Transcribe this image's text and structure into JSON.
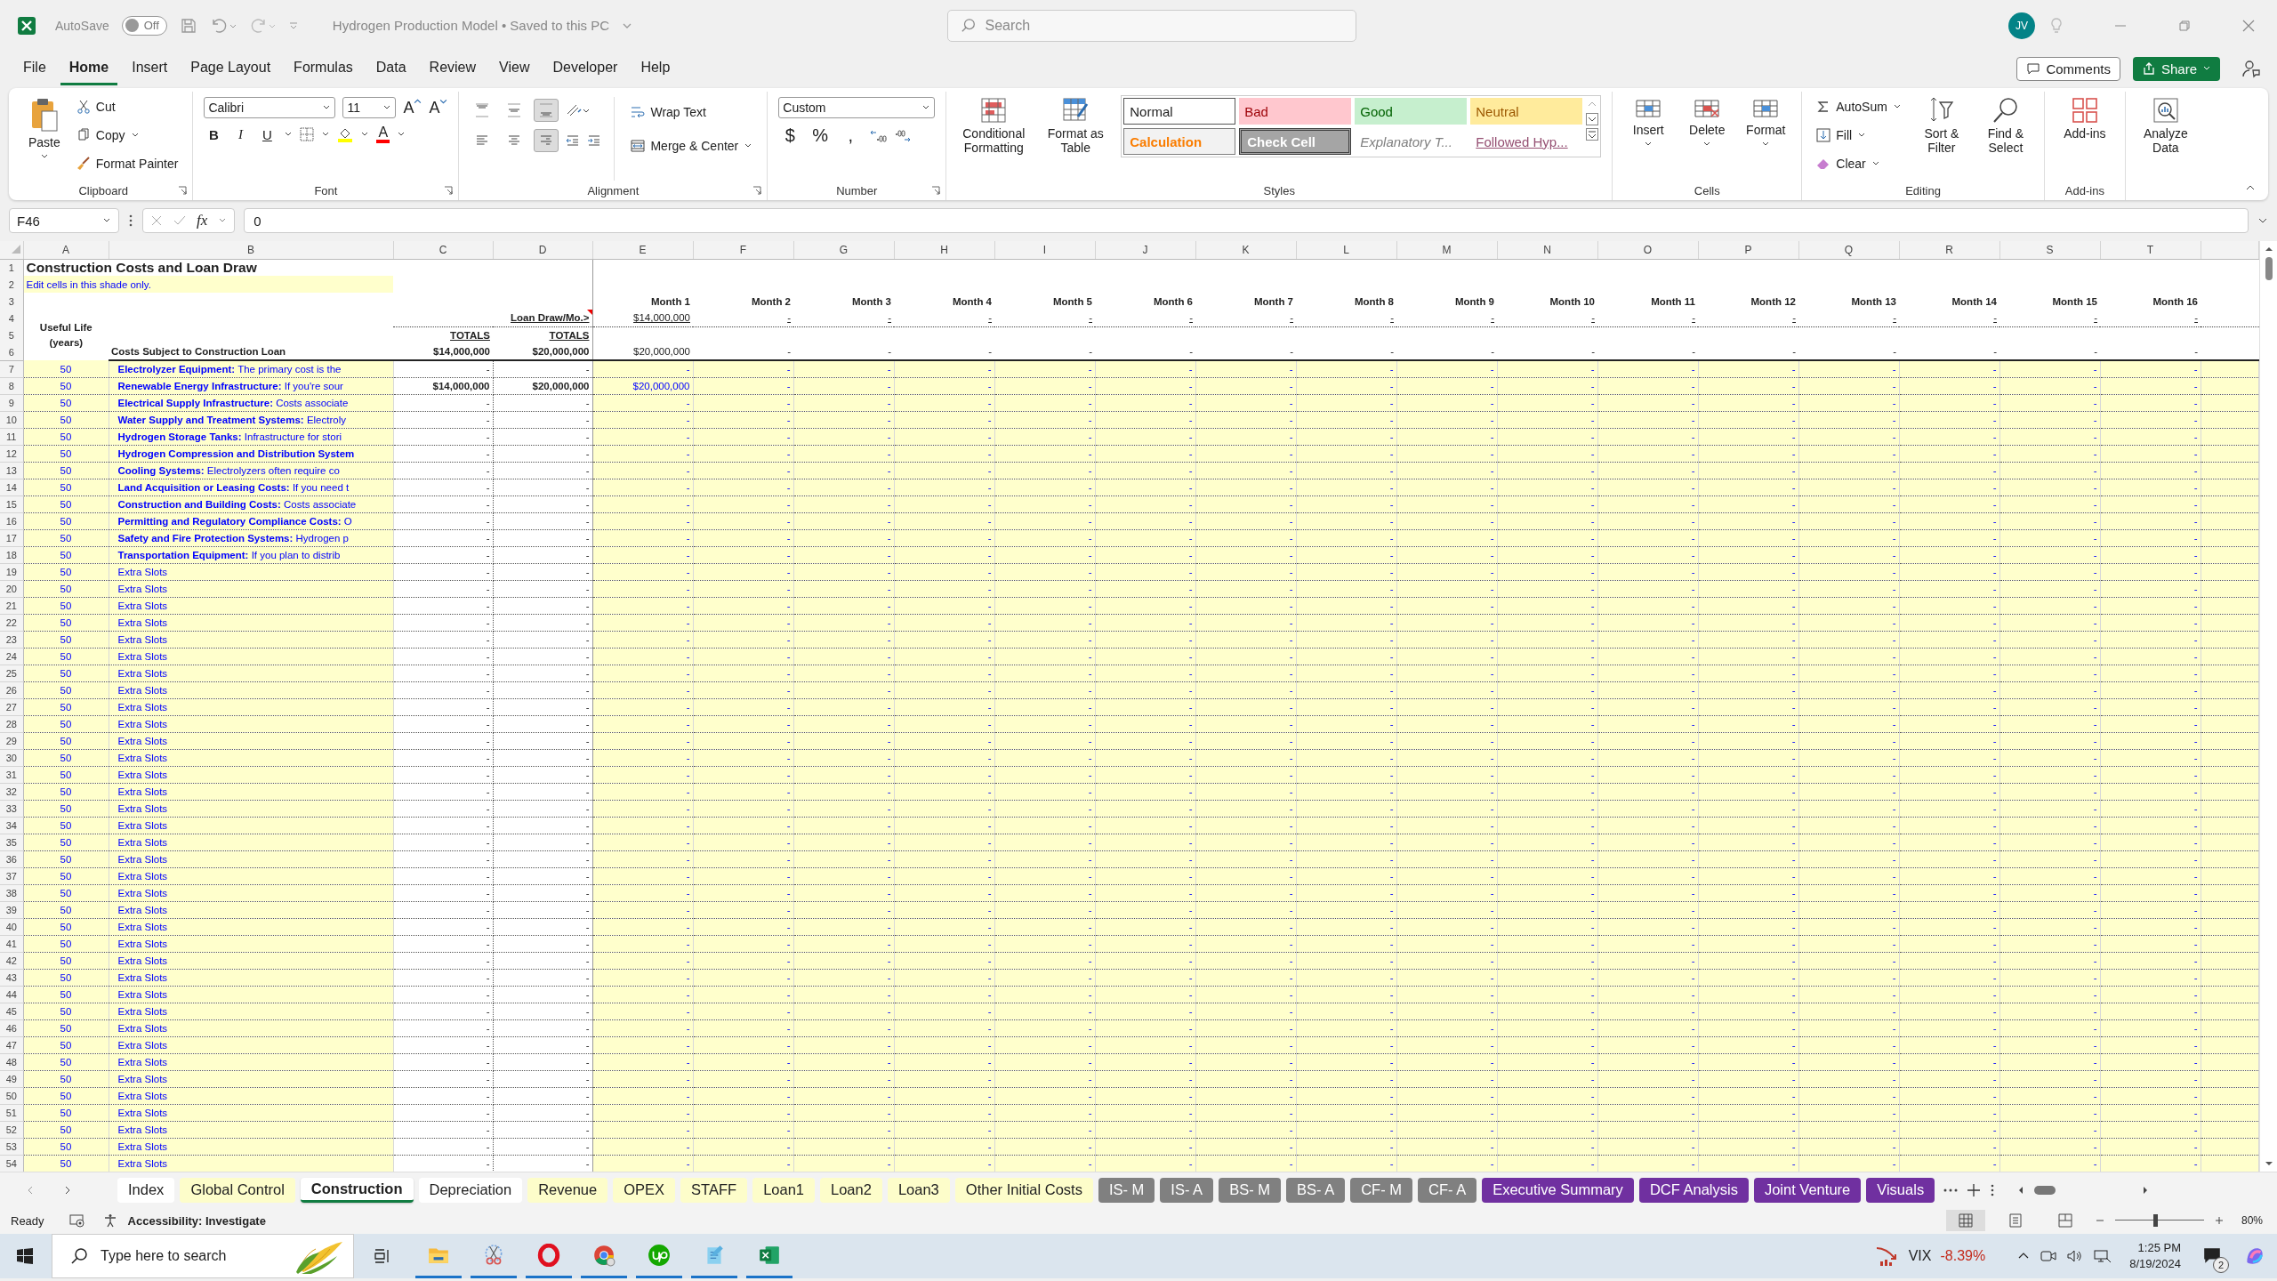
{
  "title_bar": {
    "autosave_label": "AutoSave",
    "autosave": {
      "label": "Off",
      "on": false
    },
    "document_title": "Hydrogen Production Model • Saved to this PC",
    "search_placeholder": "Search",
    "avatar": "JV"
  },
  "menu": [
    {
      "label": "File",
      "selected": false
    },
    {
      "label": "Home",
      "selected": true
    },
    {
      "label": "Insert",
      "selected": false
    },
    {
      "label": "Page Layout",
      "selected": false
    },
    {
      "label": "Formulas",
      "selected": false
    },
    {
      "label": "Data",
      "selected": false
    },
    {
      "label": "Review",
      "selected": false
    },
    {
      "label": "View",
      "selected": false
    },
    {
      "label": "Developer",
      "selected": false
    },
    {
      "label": "Help",
      "selected": false
    }
  ],
  "menu_buttons": {
    "comments": "Comments",
    "share": "Share"
  },
  "ribbon": {
    "clipboard": {
      "label": "Clipboard",
      "paste": "Paste",
      "cut": "Cut",
      "copy": "Copy",
      "format_painter": "Format Painter"
    },
    "font": {
      "label": "Font",
      "family": "Calibri",
      "size": "11",
      "size_buttons": [
        {
          "glyph": "A",
          "kind": "grow"
        },
        {
          "glyph": "A",
          "kind": "shrink"
        }
      ],
      "styles": [
        "B",
        "I",
        "U"
      ],
      "fill": {
        "color": "#ffff00"
      },
      "font_color": {
        "glyph": "A",
        "color": "#ff0000"
      }
    },
    "alignment": {
      "label": "Alignment",
      "vertical": [
        {
          "kind": "top",
          "selected": false
        },
        {
          "kind": "middle",
          "selected": false
        },
        {
          "kind": "bottom",
          "selected": true
        }
      ],
      "horizontal": [
        {
          "kind": "left",
          "selected": false
        },
        {
          "kind": "center",
          "selected": false
        },
        {
          "kind": "right",
          "selected": true
        }
      ],
      "wrap_text": "Wrap Text",
      "merge_center": "Merge & Center"
    },
    "number": {
      "label": "Number",
      "format": "Custom",
      "symbols": [
        "$",
        "%",
        ","
      ]
    },
    "styles": {
      "label": "Styles",
      "conditional_formatting": "Conditional Formatting",
      "format_as_table": "Format as Table",
      "cell_styles": [
        {
          "label": "Normal",
          "kind": "normal"
        },
        {
          "label": "Bad",
          "kind": "bad"
        },
        {
          "label": "Good",
          "kind": "good"
        },
        {
          "label": "Neutral",
          "kind": "neutral"
        },
        {
          "label": "Calculation",
          "kind": "calculation"
        },
        {
          "label": "Check Cell",
          "kind": "check"
        },
        {
          "label": "Explanatory T...",
          "kind": "explanatory"
        },
        {
          "label": "Followed Hyp...",
          "kind": "hyperlink"
        }
      ]
    },
    "cells": {
      "label": "Cells",
      "buttons": [
        {
          "label": "Insert",
          "kind": "insert"
        },
        {
          "label": "Delete",
          "kind": "delete"
        },
        {
          "label": "Format",
          "kind": "format"
        }
      ]
    },
    "editing": {
      "label": "Editing",
      "autosum": "AutoSum",
      "fill": "Fill",
      "clear": "Clear",
      "sort_filter": "Sort & Filter",
      "find_select": "Find & Select"
    },
    "addins": {
      "label": "Add-ins",
      "button": "Add-ins"
    },
    "analyze_data": "Analyze Data"
  },
  "formula_bar": {
    "name_box": "F46",
    "function_glyph": "fx",
    "formula": "0"
  },
  "sheet": {
    "columns": [
      "A",
      "B",
      "C",
      "D",
      "E",
      "F",
      "G",
      "H",
      "I",
      "J",
      "K",
      "L",
      "M",
      "N",
      "O",
      "P",
      "Q",
      "R",
      "S",
      "T"
    ],
    "header_rows": [
      "1",
      "2",
      "3",
      "4",
      "5",
      "6"
    ],
    "title": "Construction Costs and Loan Draw",
    "note": "Edit cells in this shade only.",
    "months": [
      "Month 1",
      "Month 2",
      "Month 3",
      "Month 4",
      "Month 5",
      "Month 6",
      "Month 7",
      "Month 8",
      "Month 9",
      "Month 10",
      "Month 11",
      "Month 12",
      "Month 13",
      "Month 14",
      "Month 15",
      "Month 16"
    ],
    "useful_life_label": "Useful Life (years)",
    "loan_draw_label": "Loan Draw/Mo.>",
    "loan_draw": [
      "$14,000,000",
      "-",
      "-",
      "-",
      "-",
      "-",
      "-",
      "-",
      "-",
      "-",
      "-",
      "-",
      "-",
      "-",
      "-",
      "-"
    ],
    "totals_labels": [
      "TOTALS",
      "TOTALS"
    ],
    "section_label": "Costs Subject to Construction Loan",
    "totals": [
      "$14,000,000",
      "$20,000,000"
    ],
    "month_totals": [
      "$20,000,000",
      "-",
      "-",
      "-",
      "-",
      "-",
      "-",
      "-",
      "-",
      "-",
      "-",
      "-",
      "-",
      "-",
      "-",
      "-"
    ],
    "rows": [
      {
        "n": "7",
        "life": "50",
        "term": "Electrolyzer Equipment:",
        "text": "The primary cost is the",
        "c": "-",
        "d": "-",
        "bold": false,
        "months": [
          "-",
          "-",
          "-",
          "-",
          "-",
          "-",
          "-",
          "-",
          "-",
          "-",
          "-",
          "-",
          "-",
          "-",
          "-",
          "-"
        ]
      },
      {
        "n": "8",
        "life": "50",
        "term": "Renewable Energy Infrastructure:",
        "text": "If you're sour",
        "c": "$14,000,000",
        "d": "$20,000,000",
        "bold": true,
        "months": [
          "$20,000,000",
          "-",
          "-",
          "-",
          "-",
          "-",
          "-",
          "-",
          "-",
          "-",
          "-",
          "-",
          "-",
          "-",
          "-",
          "-"
        ]
      },
      {
        "n": "9",
        "life": "50",
        "term": "Electrical Supply Infrastructure:",
        "text": "Costs associate",
        "c": "-",
        "d": "-",
        "bold": false,
        "months": [
          "-",
          "-",
          "-",
          "-",
          "-",
          "-",
          "-",
          "-",
          "-",
          "-",
          "-",
          "-",
          "-",
          "-",
          "-",
          "-"
        ]
      },
      {
        "n": "10",
        "life": "50",
        "term": "Water Supply and Treatment Systems:",
        "text": "Electroly",
        "c": "-",
        "d": "-",
        "bold": false,
        "months": [
          "-",
          "-",
          "-",
          "-",
          "-",
          "-",
          "-",
          "-",
          "-",
          "-",
          "-",
          "-",
          "-",
          "-",
          "-",
          "-"
        ]
      },
      {
        "n": "11",
        "life": "50",
        "term": "Hydrogen Storage Tanks:",
        "text": "Infrastructure for stori",
        "c": "-",
        "d": "-",
        "bold": false,
        "months": [
          "-",
          "-",
          "-",
          "-",
          "-",
          "-",
          "-",
          "-",
          "-",
          "-",
          "-",
          "-",
          "-",
          "-",
          "-",
          "-"
        ]
      },
      {
        "n": "12",
        "life": "50",
        "term": "Hydrogen Compression and Distribution System",
        "c": "-",
        "d": "-",
        "bold": false,
        "months": [
          "-",
          "-",
          "-",
          "-",
          "-",
          "-",
          "-",
          "-",
          "-",
          "-",
          "-",
          "-",
          "-",
          "-",
          "-",
          "-"
        ]
      },
      {
        "n": "13",
        "life": "50",
        "term": "Cooling Systems:",
        "text": "Electrolyzers often require co",
        "c": "-",
        "d": "-",
        "bold": false,
        "months": [
          "-",
          "-",
          "-",
          "-",
          "-",
          "-",
          "-",
          "-",
          "-",
          "-",
          "-",
          "-",
          "-",
          "-",
          "-",
          "-"
        ]
      },
      {
        "n": "14",
        "life": "50",
        "term": "Land Acquisition or Leasing Costs:",
        "text": "If you need t",
        "c": "-",
        "d": "-",
        "bold": false,
        "months": [
          "-",
          "-",
          "-",
          "-",
          "-",
          "-",
          "-",
          "-",
          "-",
          "-",
          "-",
          "-",
          "-",
          "-",
          "-",
          "-"
        ]
      },
      {
        "n": "15",
        "life": "50",
        "term": "Construction and Building Costs:",
        "text": "Costs associate",
        "c": "-",
        "d": "-",
        "bold": false,
        "months": [
          "-",
          "-",
          "-",
          "-",
          "-",
          "-",
          "-",
          "-",
          "-",
          "-",
          "-",
          "-",
          "-",
          "-",
          "-",
          "-"
        ]
      },
      {
        "n": "16",
        "life": "50",
        "term": "Permitting and Regulatory Compliance Costs:",
        "text": "O",
        "c": "-",
        "d": "-",
        "bold": false,
        "months": [
          "-",
          "-",
          "-",
          "-",
          "-",
          "-",
          "-",
          "-",
          "-",
          "-",
          "-",
          "-",
          "-",
          "-",
          "-",
          "-"
        ]
      },
      {
        "n": "17",
        "life": "50",
        "term": "Safety and Fire Protection Systems:",
        "text": "Hydrogen p",
        "c": "-",
        "d": "-",
        "bold": false,
        "months": [
          "-",
          "-",
          "-",
          "-",
          "-",
          "-",
          "-",
          "-",
          "-",
          "-",
          "-",
          "-",
          "-",
          "-",
          "-",
          "-"
        ]
      },
      {
        "n": "18",
        "life": "50",
        "term": "Transportation Equipment:",
        "text": "If you plan to distrib",
        "c": "-",
        "d": "-",
        "bold": false,
        "months": [
          "-",
          "-",
          "-",
          "-",
          "-",
          "-",
          "-",
          "-",
          "-",
          "-",
          "-",
          "-",
          "-",
          "-",
          "-",
          "-"
        ]
      },
      {
        "n": "19",
        "life": "50",
        "text": "Extra Slots",
        "c": "-",
        "d": "-",
        "bold": false,
        "months": [
          "-",
          "-",
          "-",
          "-",
          "-",
          "-",
          "-",
          "-",
          "-",
          "-",
          "-",
          "-",
          "-",
          "-",
          "-",
          "-"
        ]
      },
      {
        "n": "20",
        "life": "50",
        "text": "Extra Slots",
        "c": "-",
        "d": "-",
        "bold": false,
        "months": [
          "-",
          "-",
          "-",
          "-",
          "-",
          "-",
          "-",
          "-",
          "-",
          "-",
          "-",
          "-",
          "-",
          "-",
          "-",
          "-"
        ]
      },
      {
        "n": "21",
        "life": "50",
        "text": "Extra Slots",
        "c": "-",
        "d": "-",
        "bold": false,
        "months": [
          "-",
          "-",
          "-",
          "-",
          "-",
          "-",
          "-",
          "-",
          "-",
          "-",
          "-",
          "-",
          "-",
          "-",
          "-",
          "-"
        ]
      },
      {
        "n": "22",
        "life": "50",
        "text": "Extra Slots",
        "c": "-",
        "d": "-",
        "bold": false,
        "months": [
          "-",
          "-",
          "-",
          "-",
          "-",
          "-",
          "-",
          "-",
          "-",
          "-",
          "-",
          "-",
          "-",
          "-",
          "-",
          "-"
        ]
      },
      {
        "n": "23",
        "life": "50",
        "text": "Extra Slots",
        "c": "-",
        "d": "-",
        "bold": false,
        "months": [
          "-",
          "-",
          "-",
          "-",
          "-",
          "-",
          "-",
          "-",
          "-",
          "-",
          "-",
          "-",
          "-",
          "-",
          "-",
          "-"
        ]
      },
      {
        "n": "24",
        "life": "50",
        "text": "Extra Slots",
        "c": "-",
        "d": "-",
        "bold": false,
        "months": [
          "-",
          "-",
          "-",
          "-",
          "-",
          "-",
          "-",
          "-",
          "-",
          "-",
          "-",
          "-",
          "-",
          "-",
          "-",
          "-"
        ]
      },
      {
        "n": "25",
        "life": "50",
        "text": "Extra Slots",
        "c": "-",
        "d": "-",
        "bold": false,
        "months": [
          "-",
          "-",
          "-",
          "-",
          "-",
          "-",
          "-",
          "-",
          "-",
          "-",
          "-",
          "-",
          "-",
          "-",
          "-",
          "-"
        ]
      },
      {
        "n": "26",
        "life": "50",
        "text": "Extra Slots",
        "c": "-",
        "d": "-",
        "bold": false,
        "months": [
          "-",
          "-",
          "-",
          "-",
          "-",
          "-",
          "-",
          "-",
          "-",
          "-",
          "-",
          "-",
          "-",
          "-",
          "-",
          "-"
        ]
      },
      {
        "n": "27",
        "life": "50",
        "text": "Extra Slots",
        "c": "-",
        "d": "-",
        "bold": false,
        "months": [
          "-",
          "-",
          "-",
          "-",
          "-",
          "-",
          "-",
          "-",
          "-",
          "-",
          "-",
          "-",
          "-",
          "-",
          "-",
          "-"
        ]
      },
      {
        "n": "28",
        "life": "50",
        "text": "Extra Slots",
        "c": "-",
        "d": "-",
        "bold": false,
        "months": [
          "-",
          "-",
          "-",
          "-",
          "-",
          "-",
          "-",
          "-",
          "-",
          "-",
          "-",
          "-",
          "-",
          "-",
          "-",
          "-"
        ]
      },
      {
        "n": "29",
        "life": "50",
        "text": "Extra Slots",
        "c": "-",
        "d": "-",
        "bold": false,
        "months": [
          "-",
          "-",
          "-",
          "-",
          "-",
          "-",
          "-",
          "-",
          "-",
          "-",
          "-",
          "-",
          "-",
          "-",
          "-",
          "-"
        ]
      },
      {
        "n": "30",
        "life": "50",
        "text": "Extra Slots",
        "c": "-",
        "d": "-",
        "bold": false,
        "months": [
          "-",
          "-",
          "-",
          "-",
          "-",
          "-",
          "-",
          "-",
          "-",
          "-",
          "-",
          "-",
          "-",
          "-",
          "-",
          "-"
        ]
      },
      {
        "n": "31",
        "life": "50",
        "text": "Extra Slots",
        "c": "-",
        "d": "-",
        "bold": false,
        "months": [
          "-",
          "-",
          "-",
          "-",
          "-",
          "-",
          "-",
          "-",
          "-",
          "-",
          "-",
          "-",
          "-",
          "-",
          "-",
          "-"
        ]
      },
      {
        "n": "32",
        "life": "50",
        "text": "Extra Slots",
        "c": "-",
        "d": "-",
        "bold": false,
        "months": [
          "-",
          "-",
          "-",
          "-",
          "-",
          "-",
          "-",
          "-",
          "-",
          "-",
          "-",
          "-",
          "-",
          "-",
          "-",
          "-"
        ]
      },
      {
        "n": "33",
        "life": "50",
        "text": "Extra Slots",
        "c": "-",
        "d": "-",
        "bold": false,
        "months": [
          "-",
          "-",
          "-",
          "-",
          "-",
          "-",
          "-",
          "-",
          "-",
          "-",
          "-",
          "-",
          "-",
          "-",
          "-",
          "-"
        ]
      },
      {
        "n": "34",
        "life": "50",
        "text": "Extra Slots",
        "c": "-",
        "d": "-",
        "bold": false,
        "months": [
          "-",
          "-",
          "-",
          "-",
          "-",
          "-",
          "-",
          "-",
          "-",
          "-",
          "-",
          "-",
          "-",
          "-",
          "-",
          "-"
        ]
      },
      {
        "n": "35",
        "life": "50",
        "text": "Extra Slots",
        "c": "-",
        "d": "-",
        "bold": false,
        "months": [
          "-",
          "-",
          "-",
          "-",
          "-",
          "-",
          "-",
          "-",
          "-",
          "-",
          "-",
          "-",
          "-",
          "-",
          "-",
          "-"
        ]
      },
      {
        "n": "36",
        "life": "50",
        "text": "Extra Slots",
        "c": "-",
        "d": "-",
        "bold": false,
        "months": [
          "-",
          "-",
          "-",
          "-",
          "-",
          "-",
          "-",
          "-",
          "-",
          "-",
          "-",
          "-",
          "-",
          "-",
          "-",
          "-"
        ]
      },
      {
        "n": "37",
        "life": "50",
        "text": "Extra Slots",
        "c": "-",
        "d": "-",
        "bold": false,
        "months": [
          "-",
          "-",
          "-",
          "-",
          "-",
          "-",
          "-",
          "-",
          "-",
          "-",
          "-",
          "-",
          "-",
          "-",
          "-",
          "-"
        ]
      },
      {
        "n": "38",
        "life": "50",
        "text": "Extra Slots",
        "c": "-",
        "d": "-",
        "bold": false,
        "months": [
          "-",
          "-",
          "-",
          "-",
          "-",
          "-",
          "-",
          "-",
          "-",
          "-",
          "-",
          "-",
          "-",
          "-",
          "-",
          "-"
        ]
      },
      {
        "n": "39",
        "life": "50",
        "text": "Extra Slots",
        "c": "-",
        "d": "-",
        "bold": false,
        "months": [
          "-",
          "-",
          "-",
          "-",
          "-",
          "-",
          "-",
          "-",
          "-",
          "-",
          "-",
          "-",
          "-",
          "-",
          "-",
          "-"
        ]
      },
      {
        "n": "40",
        "life": "50",
        "text": "Extra Slots",
        "c": "-",
        "d": "-",
        "bold": false,
        "months": [
          "-",
          "-",
          "-",
          "-",
          "-",
          "-",
          "-",
          "-",
          "-",
          "-",
          "-",
          "-",
          "-",
          "-",
          "-",
          "-"
        ]
      },
      {
        "n": "41",
        "life": "50",
        "text": "Extra Slots",
        "c": "-",
        "d": "-",
        "bold": false,
        "months": [
          "-",
          "-",
          "-",
          "-",
          "-",
          "-",
          "-",
          "-",
          "-",
          "-",
          "-",
          "-",
          "-",
          "-",
          "-",
          "-"
        ]
      },
      {
        "n": "42",
        "life": "50",
        "text": "Extra Slots",
        "c": "-",
        "d": "-",
        "bold": false,
        "months": [
          "-",
          "-",
          "-",
          "-",
          "-",
          "-",
          "-",
          "-",
          "-",
          "-",
          "-",
          "-",
          "-",
          "-",
          "-",
          "-"
        ]
      },
      {
        "n": "43",
        "life": "50",
        "text": "Extra Slots",
        "c": "-",
        "d": "-",
        "bold": false,
        "months": [
          "-",
          "-",
          "-",
          "-",
          "-",
          "-",
          "-",
          "-",
          "-",
          "-",
          "-",
          "-",
          "-",
          "-",
          "-",
          "-"
        ]
      },
      {
        "n": "44",
        "life": "50",
        "text": "Extra Slots",
        "c": "-",
        "d": "-",
        "bold": false,
        "months": [
          "-",
          "-",
          "-",
          "-",
          "-",
          "-",
          "-",
          "-",
          "-",
          "-",
          "-",
          "-",
          "-",
          "-",
          "-",
          "-"
        ]
      },
      {
        "n": "45",
        "life": "50",
        "text": "Extra Slots",
        "c": "-",
        "d": "-",
        "bold": false,
        "months": [
          "-",
          "-",
          "-",
          "-",
          "-",
          "-",
          "-",
          "-",
          "-",
          "-",
          "-",
          "-",
          "-",
          "-",
          "-",
          "-"
        ]
      },
      {
        "n": "46",
        "life": "50",
        "text": "Extra Slots",
        "c": "-",
        "d": "-",
        "bold": false,
        "months": [
          "-",
          "-",
          "-",
          "-",
          "-",
          "-",
          "-",
          "-",
          "-",
          "-",
          "-",
          "-",
          "-",
          "-",
          "-",
          "-"
        ]
      },
      {
        "n": "47",
        "life": "50",
        "text": "Extra Slots",
        "c": "-",
        "d": "-",
        "bold": false,
        "months": [
          "-",
          "-",
          "-",
          "-",
          "-",
          "-",
          "-",
          "-",
          "-",
          "-",
          "-",
          "-",
          "-",
          "-",
          "-",
          "-"
        ]
      },
      {
        "n": "48",
        "life": "50",
        "text": "Extra Slots",
        "c": "-",
        "d": "-",
        "bold": false,
        "months": [
          "-",
          "-",
          "-",
          "-",
          "-",
          "-",
          "-",
          "-",
          "-",
          "-",
          "-",
          "-",
          "-",
          "-",
          "-",
          "-"
        ]
      },
      {
        "n": "49",
        "life": "50",
        "text": "Extra Slots",
        "c": "-",
        "d": "-",
        "bold": false,
        "months": [
          "-",
          "-",
          "-",
          "-",
          "-",
          "-",
          "-",
          "-",
          "-",
          "-",
          "-",
          "-",
          "-",
          "-",
          "-",
          "-"
        ]
      },
      {
        "n": "50",
        "life": "50",
        "text": "Extra Slots",
        "c": "-",
        "d": "-",
        "bold": false,
        "months": [
          "-",
          "-",
          "-",
          "-",
          "-",
          "-",
          "-",
          "-",
          "-",
          "-",
          "-",
          "-",
          "-",
          "-",
          "-",
          "-"
        ]
      },
      {
        "n": "51",
        "life": "50",
        "text": "Extra Slots",
        "c": "-",
        "d": "-",
        "bold": false,
        "months": [
          "-",
          "-",
          "-",
          "-",
          "-",
          "-",
          "-",
          "-",
          "-",
          "-",
          "-",
          "-",
          "-",
          "-",
          "-",
          "-"
        ]
      },
      {
        "n": "52",
        "life": "50",
        "text": "Extra Slots",
        "c": "-",
        "d": "-",
        "bold": false,
        "months": [
          "-",
          "-",
          "-",
          "-",
          "-",
          "-",
          "-",
          "-",
          "-",
          "-",
          "-",
          "-",
          "-",
          "-",
          "-",
          "-"
        ]
      },
      {
        "n": "53",
        "life": "50",
        "text": "Extra Slots",
        "c": "-",
        "d": "-",
        "bold": false,
        "months": [
          "-",
          "-",
          "-",
          "-",
          "-",
          "-",
          "-",
          "-",
          "-",
          "-",
          "-",
          "-",
          "-",
          "-",
          "-",
          "-"
        ]
      },
      {
        "n": "54",
        "life": "50",
        "text": "Extra Slots",
        "c": "-",
        "d": "-",
        "bold": false,
        "months": [
          "-",
          "-",
          "-",
          "-",
          "-",
          "-",
          "-",
          "-",
          "-",
          "-",
          "-",
          "-",
          "-",
          "-",
          "-",
          "-"
        ]
      }
    ]
  },
  "sheet_tabs": [
    {
      "label": "Index",
      "selected": false
    },
    {
      "label": "Global Control",
      "selected": false,
      "color": "#fdfdca"
    },
    {
      "label": "Construction",
      "selected": true
    },
    {
      "label": "Depreciation",
      "selected": false
    },
    {
      "label": "Revenue",
      "selected": false,
      "color": "#fdfdca"
    },
    {
      "label": "OPEX",
      "selected": false,
      "color": "#fdfdca"
    },
    {
      "label": "STAFF",
      "selected": false,
      "color": "#fdfdca"
    },
    {
      "label": "Loan1",
      "selected": false,
      "color": "#fdfdca"
    },
    {
      "label": "Loan2",
      "selected": false,
      "color": "#fdfdca"
    },
    {
      "label": "Loan3",
      "selected": false,
      "color": "#fdfdca"
    },
    {
      "label": "Other Initial Costs",
      "selected": false,
      "color": "#fdfdca"
    },
    {
      "label": "IS- M",
      "selected": false,
      "color": "#808080"
    },
    {
      "label": "IS- A",
      "selected": false,
      "color": "#808080"
    },
    {
      "label": "BS- M",
      "selected": false,
      "color": "#808080"
    },
    {
      "label": "BS- A",
      "selected": false,
      "color": "#808080"
    },
    {
      "label": "CF- M",
      "selected": false,
      "color": "#808080"
    },
    {
      "label": "CF- A",
      "selected": false,
      "color": "#808080"
    },
    {
      "label": "Executive Summary",
      "selected": false,
      "color": "#7030a0"
    },
    {
      "label": "DCF Analysis",
      "selected": false,
      "color": "#7030a0"
    },
    {
      "label": "Joint Venture",
      "selected": false,
      "color": "#7030a0"
    },
    {
      "label": "Visuals",
      "selected": false,
      "color": "#7030a0"
    }
  ],
  "status_bar": {
    "mode": "Ready",
    "accessibility": "Accessibility: Investigate",
    "zoom_slider": {
      "level": 0.45
    },
    "zoom": "80%"
  },
  "taskbar": {
    "search_placeholder": "Type here to search",
    "apps": [
      {
        "kind": "explorer",
        "running": true
      },
      {
        "kind": "snipping",
        "running": true
      },
      {
        "kind": "opera",
        "running": true
      },
      {
        "kind": "chrome",
        "running": true
      },
      {
        "kind": "upwork",
        "running": true
      },
      {
        "kind": "notepad",
        "running": true
      },
      {
        "kind": "excel",
        "running": true
      }
    ],
    "ticker": {
      "symbol": "VIX",
      "change": "-8.39%"
    },
    "time": "1:25 PM",
    "date": "8/19/2024",
    "notifications": "2"
  }
}
